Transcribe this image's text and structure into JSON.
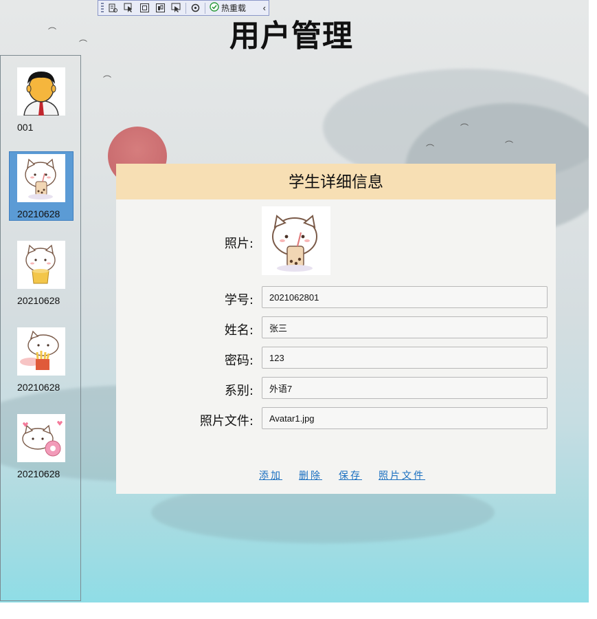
{
  "app": {
    "title": "用户管理"
  },
  "toolbar": {
    "icons": [
      "live-visual-tree-icon",
      "select-element-icon",
      "display-layout-adorners-icon",
      "track-focus-icon",
      "preview-icon",
      "hot-reload-status-icon"
    ],
    "hot_reload_label": "热重载",
    "collapse_glyph": "‹"
  },
  "sidebar": {
    "items": [
      {
        "label": "001",
        "avatar": "man-avatar"
      },
      {
        "label": "20210628",
        "avatar": "cat-milk-tea-avatar",
        "selected": true
      },
      {
        "label": "20210628",
        "avatar": "cat-chips-avatar"
      },
      {
        "label": "20210628",
        "avatar": "cat-fries-avatar"
      },
      {
        "label": "20210628",
        "avatar": "cat-donut-avatar"
      }
    ]
  },
  "detail": {
    "header": "学生详细信息",
    "labels": {
      "photo": "照片:",
      "id": "学号:",
      "name": "姓名:",
      "password": "密码:",
      "department": "系别:",
      "photo_file": "照片文件:"
    },
    "values": {
      "id": "2021062801",
      "name": "张三",
      "password": "123",
      "department": "外语7",
      "photo_file": "Avatar1.jpg"
    },
    "actions": {
      "add": "添加",
      "delete": "删除",
      "save": "保存",
      "photo_file": "照片文件"
    }
  },
  "colors": {
    "header_bg": "#f7dfb4",
    "panel_bg": "#f4f4f2",
    "selected_bg": "#5b9bd5",
    "link": "#1a6fc0"
  }
}
